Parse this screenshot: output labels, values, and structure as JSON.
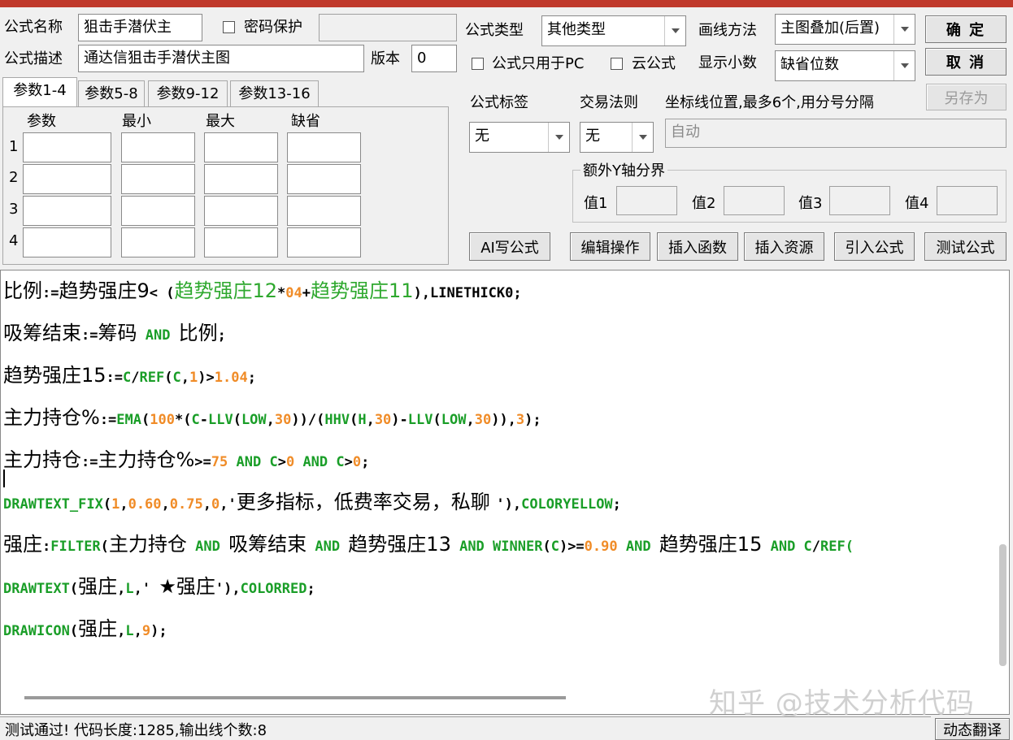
{
  "form": {
    "name_label": "公式名称",
    "name_value": "狙击手潜伏主",
    "password_label": "密码保护",
    "desc_label": "公式描述",
    "desc_value": "通达信狙击手潜伏主图",
    "version_label": "版本",
    "version_value": "0",
    "type_label": "公式类型",
    "type_value": "其他类型",
    "draw_label": "画线方法",
    "draw_value": "主图叠加(后置)",
    "pc_only_label": "公式只用于PC",
    "cloud_label": "云公式",
    "decimal_label": "显示小数",
    "decimal_value": "缺省位数",
    "confirm_button": "确 定",
    "cancel_button": "取 消",
    "save_as_button": "另存为"
  },
  "param_tabs": [
    "参数1-4",
    "参数5-8",
    "参数9-12",
    "参数13-16"
  ],
  "param_table": {
    "headers": [
      "参数",
      "最小",
      "最大",
      "缺省"
    ],
    "rows": [
      "1",
      "2",
      "3",
      "4"
    ]
  },
  "tags": {
    "tag_label": "公式标签",
    "tag_value": "无",
    "rule_label": "交易法则",
    "rule_value": "无",
    "coord_label": "坐标线位置,最多6个,用分号分隔",
    "coord_value": "自动",
    "yaxis_label": "额外Y轴分界",
    "v1": "值1",
    "v2": "值2",
    "v3": "值3",
    "v4": "值4"
  },
  "toolbar": {
    "ai": "AI写公式",
    "edit": "编辑操作",
    "insert_func": "插入函数",
    "insert_res": "插入资源",
    "import": "引入公式",
    "test": "测试公式"
  },
  "code": {
    "l1": [
      "比例",
      ":=",
      "趋势强庄9",
      "< (",
      "趋势强庄12",
      "*",
      "04",
      "+",
      "趋势强庄11",
      "),LINETHICK0;"
    ],
    "l2": [
      "吸筹结束",
      ":=",
      "筹码",
      " AND ",
      "比例",
      ";"
    ],
    "l3": [
      "趋势强庄15",
      ":=",
      "C",
      "/",
      "REF",
      "(",
      "C",
      ",",
      "1",
      ")>",
      "1.04",
      ";"
    ],
    "l4": [
      "主力持仓%",
      ":=",
      "EMA",
      "(",
      "100",
      "*(",
      "C",
      "-",
      "LLV",
      "(",
      "LOW",
      ",",
      "30",
      "))/(",
      "HHV",
      "(",
      "H",
      ",",
      "30",
      ")-",
      "LLV",
      "(",
      "LOW",
      ",",
      "30",
      ")),",
      "3",
      ");"
    ],
    "l5": [
      "主力持仓",
      ":=",
      "主力持仓%",
      ">=",
      "75",
      " AND ",
      "C",
      ">",
      "0",
      " AND ",
      "C",
      ">",
      "0",
      ";"
    ],
    "l6": [
      "DRAWTEXT_FIX",
      "(",
      "1",
      ",",
      "0.60",
      ",",
      "0.75",
      ",",
      "0",
      ",'",
      "更多指标，低费率交易，私聊 ",
      "'),",
      "COLORYELLOW",
      ";"
    ],
    "l7": [
      "强庄",
      ":",
      "FILTER",
      "(",
      "主力持仓",
      " AND ",
      "吸筹结束",
      " AND ",
      "趋势强庄13",
      " AND ",
      "WINNER",
      "(",
      "C",
      ")>=",
      "0.90",
      " AND ",
      "趋势强庄15",
      " AND ",
      "C",
      "/",
      "REF("
    ],
    "l8": [
      "DRAWTEXT",
      "(",
      "强庄",
      ",",
      "L",
      ",' ",
      "★强庄",
      "'),",
      "COLORRED",
      ";"
    ],
    "l9": [
      "DRAWICON",
      "(",
      "强庄",
      ",",
      "L",
      ",",
      "9",
      ");"
    ]
  },
  "status": {
    "text": "测试通过! 代码长度:1285,输出线个数:8",
    "translate_button": "动态翻译"
  },
  "watermark": "知乎 @技术分析代码"
}
